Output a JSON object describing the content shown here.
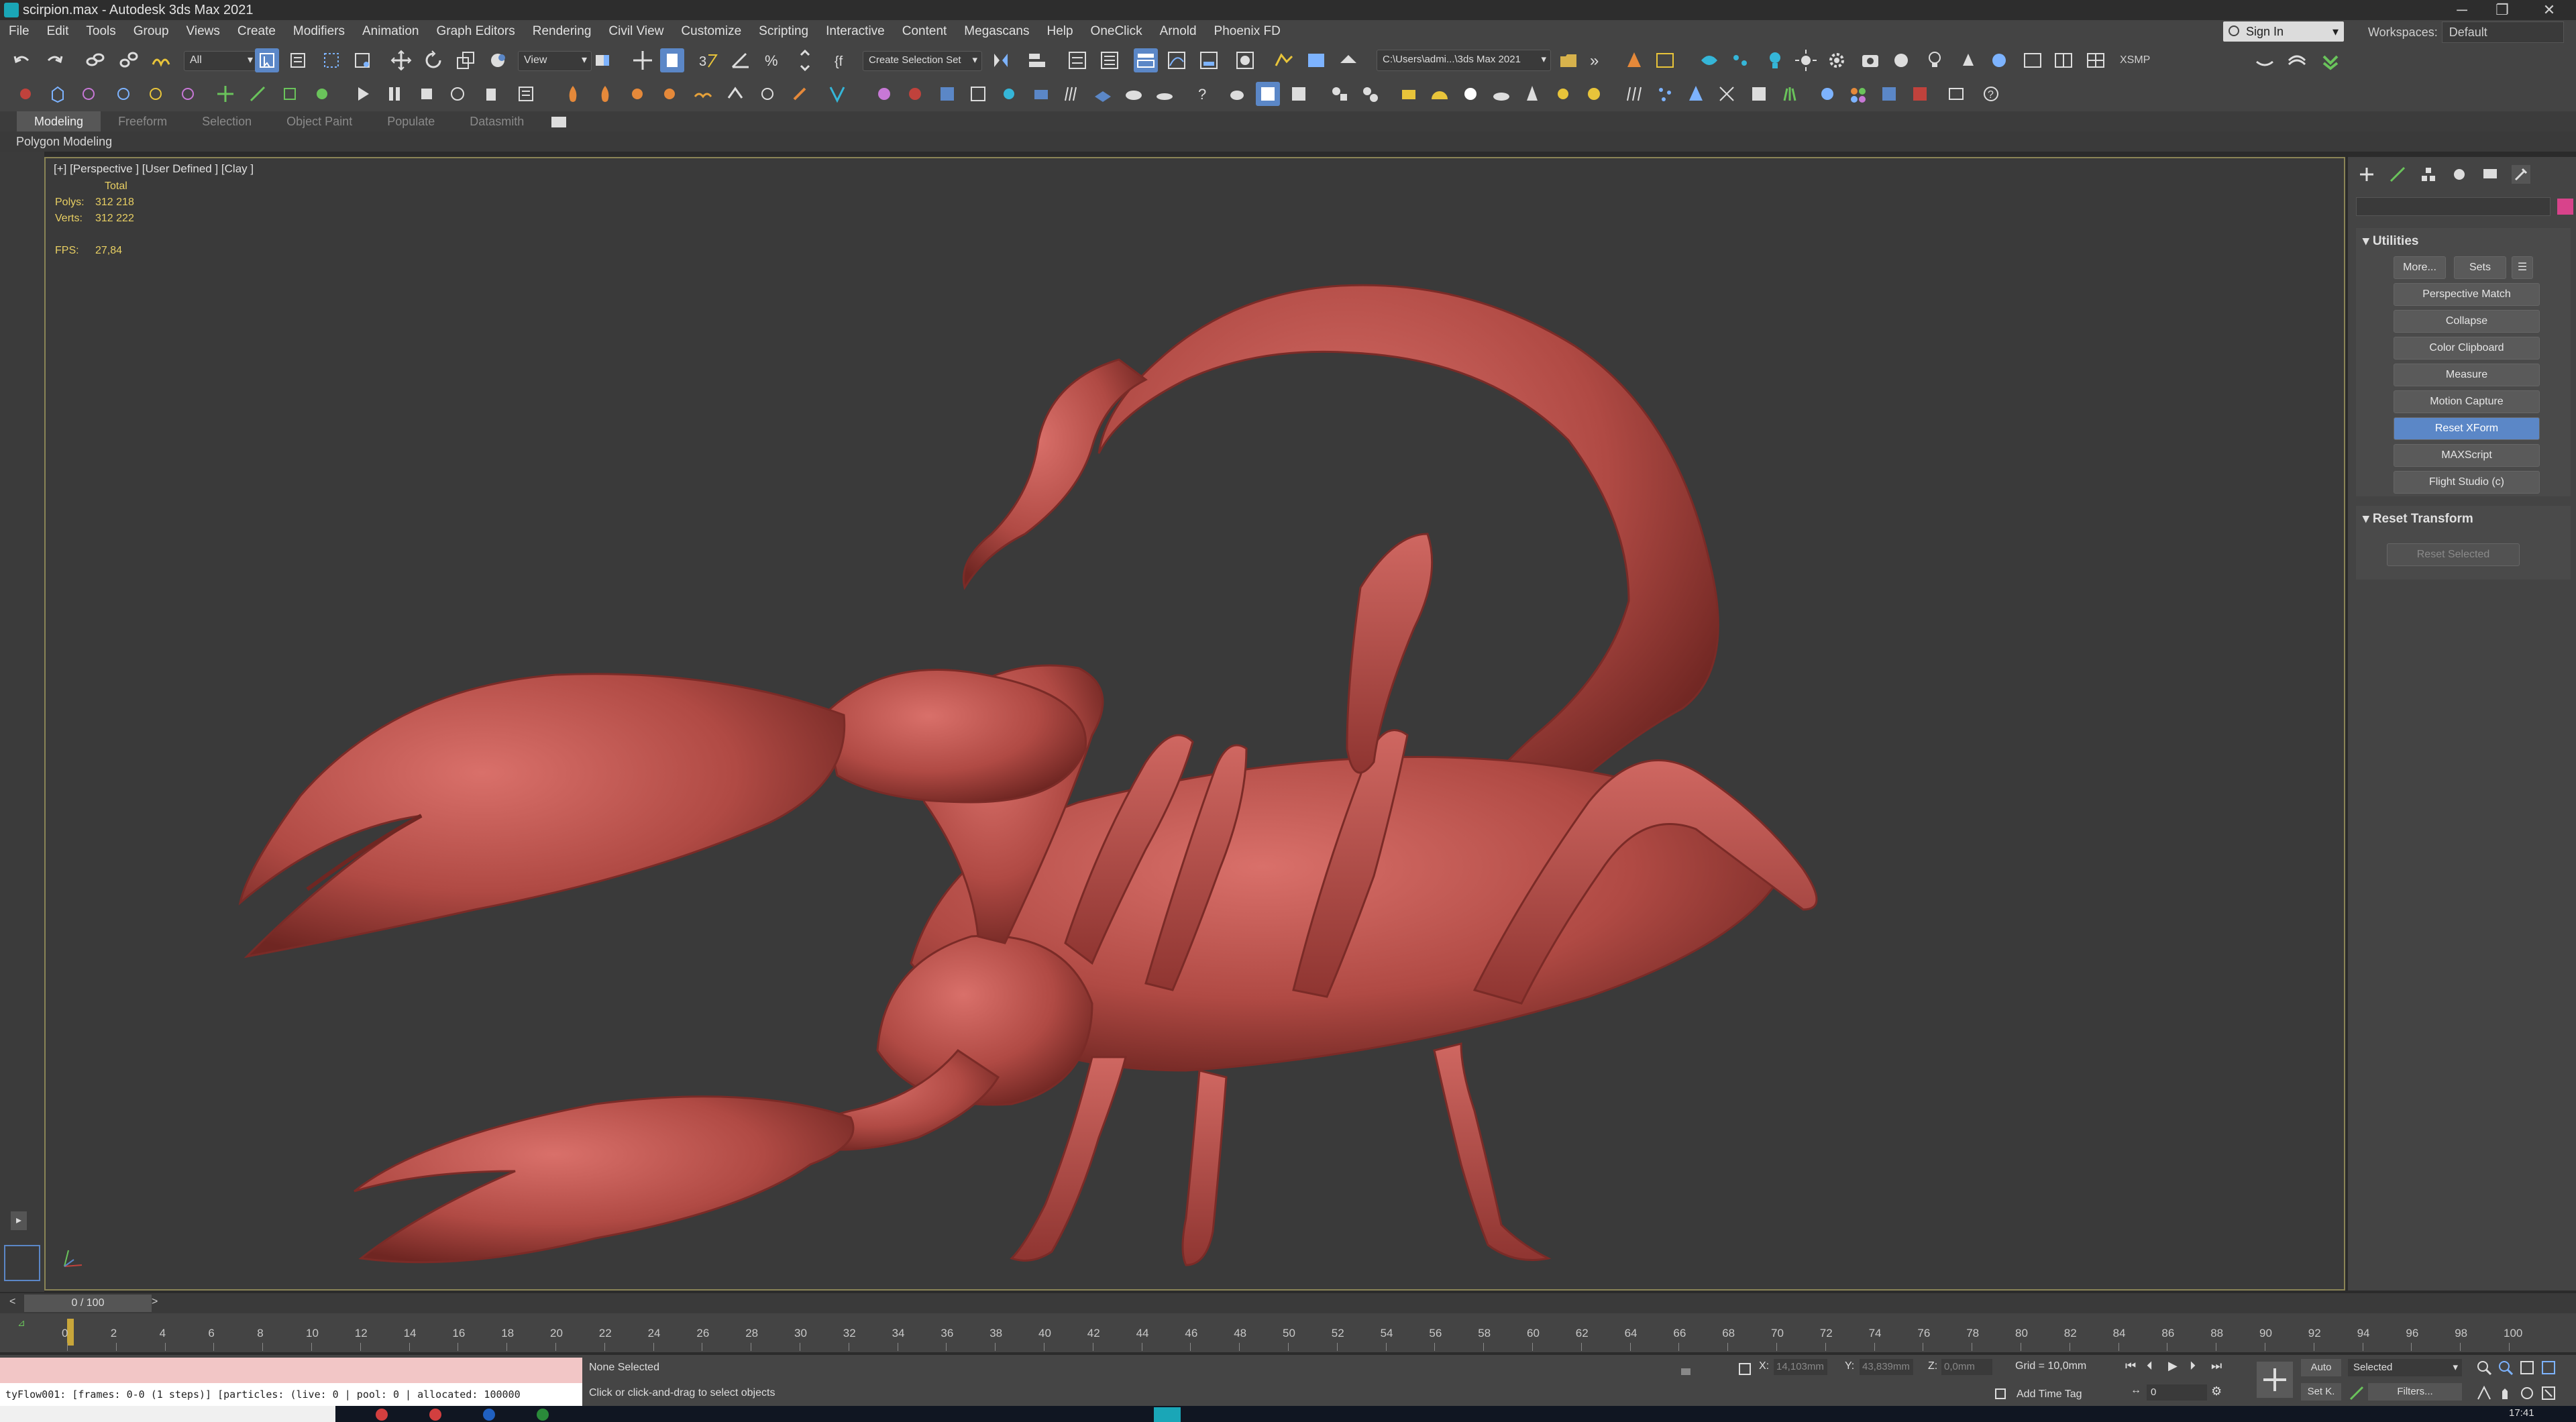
{
  "window": {
    "title": "scirpion.max - Autodesk 3ds Max 2021",
    "minimize": "─",
    "maximize": "❐",
    "close": "✕"
  },
  "menu": [
    "File",
    "Edit",
    "Tools",
    "Group",
    "Views",
    "Create",
    "Modifiers",
    "Animation",
    "Graph Editors",
    "Rendering",
    "Civil View",
    "Customize",
    "Scripting",
    "Interactive",
    "Content",
    "Megascans",
    "Help",
    "OneClick",
    "Arnold",
    "Phoenix FD"
  ],
  "signin": {
    "label": "Sign In"
  },
  "workspace": {
    "label": "Workspaces:",
    "value": "Default"
  },
  "toolbar": {
    "filter_dropdown": "All",
    "refcoord_dropdown": "View",
    "selection_set": "Create Selection Set",
    "project_path": "C:\\Users\\admi...\\3ds Max 2021",
    "xsmp": "XSMP"
  },
  "ribbon": {
    "tabs": [
      "Modeling",
      "Freeform",
      "Selection",
      "Object Paint",
      "Populate",
      "Datasmith"
    ],
    "active_tab": "Modeling",
    "sub": "Polygon Modeling"
  },
  "viewport": {
    "label": "[+] [Perspective ] [User Defined ] [Clay ]",
    "stats_total": "Total",
    "polys_label": "Polys:",
    "polys_value": "312 218",
    "verts_label": "Verts:",
    "verts_value": "312 222",
    "fps_label": "FPS:",
    "fps_value": "27,84"
  },
  "command_panel": {
    "utilities_title": "Utilities",
    "more_button": "More...",
    "sets_button": "Sets",
    "utility_buttons": [
      "Perspective Match",
      "Collapse",
      "Color Clipboard",
      "Measure",
      "Motion Capture",
      "Reset XForm",
      "MAXScript",
      "Flight Studio (c)"
    ],
    "active_button": "Reset XForm",
    "reset_transform_title": "Reset Transform",
    "reset_selected": "Reset Selected"
  },
  "timeline": {
    "frame_display": "0 / 100",
    "ticks": [
      "0",
      "2",
      "4",
      "6",
      "8",
      "10",
      "12",
      "14",
      "16",
      "18",
      "20",
      "22",
      "24",
      "26",
      "28",
      "30",
      "32",
      "34",
      "36",
      "38",
      "40",
      "42",
      "44",
      "46",
      "48",
      "50",
      "52",
      "54",
      "56",
      "58",
      "60",
      "62",
      "64",
      "66",
      "68",
      "70",
      "72",
      "74",
      "76",
      "78",
      "80",
      "82",
      "84",
      "86",
      "88",
      "90",
      "92",
      "94",
      "96",
      "98",
      "100"
    ]
  },
  "status": {
    "script_output": "tyFlow001: [frames: 0-0 (1 steps)] [particles: (live: 0 | pool: 0 | allocated: 100000",
    "selection": "None Selected",
    "prompt": "Click or click-and-drag to select objects",
    "x_label": "X:",
    "x_value": "14,103mm",
    "y_label": "Y:",
    "y_value": "43,839mm",
    "z_label": "Z:",
    "z_value": "0,0mm",
    "grid": "Grid = 10,0mm",
    "add_time_tag": "Add Time Tag",
    "auto": "Auto",
    "set_k": "Set K.",
    "key_filter": "Selected",
    "filters": "Filters...",
    "current_frame": "0"
  },
  "taskbar": {
    "clock": "17:41"
  }
}
